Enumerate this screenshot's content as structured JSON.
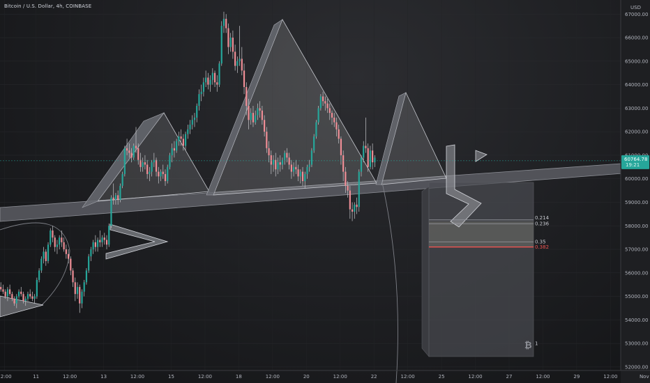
{
  "header": {
    "title": "Bitcoin / U.S. Dollar, 4h, COINBASE"
  },
  "price_axis": {
    "currency": "USD"
  },
  "current_price": {
    "value": "60764.78",
    "countdown": "19:21",
    "price": 60764.78
  },
  "colors": {
    "up": "#26a69a",
    "down": "#ef8e96",
    "wick": "#c8c8cc",
    "price_tag": "#26a69a",
    "fib_0382": "#ef5350"
  },
  "icons": {
    "bitcoin": "bitcoin-icon"
  },
  "chart_data": {
    "type": "candlestick",
    "y_axis": {
      "ticks": [
        67000,
        66000,
        65000,
        64000,
        63000,
        62000,
        61000,
        60000,
        59000,
        58000,
        57000,
        56000,
        55000,
        54000,
        53000,
        52000
      ],
      "tick_labels": [
        "67000.00",
        "66000.00",
        "65000.00",
        "64000.00",
        "63000.00",
        "62000.00",
        "61000.00",
        "60000.00",
        "59000.00",
        "58000.00",
        "57000.00",
        "56000.00",
        "55000.00",
        "54000.00",
        "53000.00",
        "52000.00"
      ],
      "range": [
        51850,
        67600
      ]
    },
    "x_axis": {
      "tick_labels": [
        "12:00",
        "11",
        "12:00",
        "13",
        "12:00",
        "15",
        "12:00",
        "18",
        "12:00",
        "20",
        "12:00",
        "22",
        "12:00",
        "25",
        "12:00",
        "27",
        "12:00",
        "29",
        "12:00",
        "Nov",
        "3"
      ],
      "tick_bars": [
        2,
        16,
        31,
        46,
        61,
        76,
        91,
        106,
        121,
        136,
        151,
        166,
        181,
        196,
        211,
        226,
        241,
        256,
        271,
        286,
        301
      ]
    },
    "fib_levels": [
      {
        "label": "0.214",
        "price": 58250
      },
      {
        "label": "0.236",
        "price": 58090
      },
      {
        "label": "0.35",
        "price": 57320
      },
      {
        "label": "0.382",
        "price": 57100
      },
      {
        "label": "1",
        "price": 53000
      }
    ],
    "candles": [
      [
        55400,
        55600,
        55300,
        55200
      ],
      [
        55300,
        55500,
        55200,
        55100
      ],
      [
        55200,
        55300,
        55000,
        54900
      ],
      [
        55000,
        55400,
        55300,
        54800
      ],
      [
        55300,
        55500,
        55100,
        55000
      ],
      [
        55100,
        55200,
        54900,
        54800
      ],
      [
        54900,
        55000,
        54700,
        54600
      ],
      [
        54700,
        55100,
        55000,
        54500
      ],
      [
        55000,
        55300,
        55200,
        54900
      ],
      [
        55200,
        55400,
        55100,
        55000
      ],
      [
        55100,
        55200,
        54800,
        54700
      ],
      [
        54800,
        55000,
        54900,
        54600
      ],
      [
        54900,
        55200,
        55100,
        54800
      ],
      [
        55100,
        55300,
        55000,
        54900
      ],
      [
        55000,
        55200,
        54900,
        54800
      ],
      [
        54900,
        55100,
        55000,
        54700
      ],
      [
        55000,
        55800,
        55700,
        54900
      ],
      [
        55700,
        56200,
        56100,
        55600
      ],
      [
        56100,
        56700,
        56600,
        56000
      ],
      [
        56600,
        57100,
        56900,
        56400
      ],
      [
        56900,
        57000,
        56500,
        56300
      ],
      [
        56500,
        57300,
        57200,
        56400
      ],
      [
        57200,
        57900,
        57800,
        57100
      ],
      [
        57800,
        58000,
        57500,
        57300
      ],
      [
        57500,
        57600,
        57100,
        56900
      ],
      [
        57100,
        57400,
        57200,
        56800
      ],
      [
        57200,
        57600,
        57500,
        57000
      ],
      [
        57500,
        57800,
        57300,
        57100
      ],
      [
        57300,
        57500,
        57000,
        56900
      ],
      [
        57000,
        57200,
        56800,
        56600
      ],
      [
        56800,
        57000,
        56600,
        56400
      ],
      [
        56600,
        56700,
        56100,
        55900
      ],
      [
        56100,
        56200,
        55600,
        55400
      ],
      [
        55600,
        55800,
        55100,
        54800
      ],
      [
        55100,
        55600,
        55400,
        54900
      ],
      [
        55400,
        55500,
        54700,
        54300
      ],
      [
        54700,
        55300,
        55200,
        54500
      ],
      [
        55200,
        55700,
        55600,
        55000
      ],
      [
        55600,
        56200,
        56100,
        55500
      ],
      [
        56100,
        56800,
        56700,
        56000
      ],
      [
        56700,
        57100,
        57000,
        56500
      ],
      [
        57000,
        57400,
        57300,
        56800
      ],
      [
        57300,
        57600,
        57100,
        56900
      ],
      [
        57100,
        57500,
        57400,
        56900
      ],
      [
        57400,
        57800,
        57300,
        57100
      ],
      [
        57300,
        57600,
        57500,
        57100
      ],
      [
        57500,
        57700,
        57400,
        57200
      ],
      [
        57400,
        57600,
        57200,
        57000
      ],
      [
        57200,
        58100,
        58000,
        57100
      ],
      [
        58000,
        59300,
        59200,
        57900
      ],
      [
        59200,
        59800,
        59100,
        58900
      ],
      [
        59100,
        59400,
        59300,
        58900
      ],
      [
        59300,
        59500,
        59100,
        58900
      ],
      [
        59100,
        59800,
        59700,
        59000
      ],
      [
        59700,
        60300,
        60200,
        59600
      ],
      [
        60200,
        61400,
        61300,
        60100
      ],
      [
        61300,
        61700,
        61200,
        61000
      ],
      [
        61200,
        61500,
        61100,
        60900
      ],
      [
        61100,
        61300,
        60900,
        60700
      ],
      [
        60900,
        61500,
        61400,
        60800
      ],
      [
        61400,
        62200,
        61300,
        61100
      ],
      [
        61300,
        61500,
        60800,
        60600
      ],
      [
        60800,
        61100,
        60500,
        60300
      ],
      [
        60500,
        60900,
        60700,
        60300
      ],
      [
        60700,
        61000,
        60600,
        60400
      ],
      [
        60600,
        60800,
        60200,
        60000
      ],
      [
        60200,
        60500,
        60300,
        59900
      ],
      [
        60300,
        60800,
        60700,
        60100
      ],
      [
        60700,
        61100,
        60800,
        60500
      ],
      [
        60800,
        60900,
        60300,
        60100
      ],
      [
        60300,
        60500,
        60100,
        59800
      ],
      [
        60100,
        60400,
        60300,
        59900
      ],
      [
        60300,
        60600,
        60200,
        60000
      ],
      [
        60200,
        60400,
        59900,
        59700
      ],
      [
        59900,
        60600,
        60500,
        59800
      ],
      [
        60500,
        61100,
        61000,
        60400
      ],
      [
        61000,
        61500,
        61300,
        60700
      ],
      [
        61300,
        61600,
        61200,
        60900
      ],
      [
        61200,
        61700,
        61600,
        61100
      ],
      [
        61600,
        62000,
        61800,
        61400
      ],
      [
        61800,
        62100,
        61700,
        61400
      ],
      [
        61700,
        61900,
        61400,
        61200
      ],
      [
        61400,
        62000,
        61900,
        61200
      ],
      [
        61900,
        62300,
        62100,
        61700
      ],
      [
        62100,
        62500,
        62300,
        61900
      ],
      [
        62300,
        62700,
        62500,
        62100
      ],
      [
        62500,
        62800,
        62600,
        62200
      ],
      [
        62600,
        63200,
        63100,
        62400
      ],
      [
        63100,
        63800,
        63600,
        62900
      ],
      [
        63600,
        64000,
        63700,
        63300
      ],
      [
        63700,
        64300,
        64100,
        63500
      ],
      [
        64100,
        64600,
        64300,
        63900
      ],
      [
        64300,
        64500,
        64000,
        63800
      ],
      [
        64000,
        64400,
        64200,
        63700
      ],
      [
        64200,
        64700,
        64500,
        64000
      ],
      [
        64500,
        64600,
        64100,
        63900
      ],
      [
        64100,
        64400,
        64000,
        63700
      ],
      [
        64000,
        65000,
        64900,
        63900
      ],
      [
        64900,
        66700,
        66500,
        64800
      ],
      [
        66500,
        67100,
        66800,
        66200
      ],
      [
        66800,
        67000,
        66400,
        66200
      ],
      [
        66400,
        66600,
        65600,
        65300
      ],
      [
        65600,
        66200,
        66000,
        65400
      ],
      [
        66000,
        66300,
        65400,
        65100
      ],
      [
        65400,
        65700,
        64800,
        64600
      ],
      [
        64800,
        65200,
        65000,
        64500
      ],
      [
        65000,
        66500,
        65100,
        64800
      ],
      [
        65100,
        65600,
        64600,
        64400
      ],
      [
        64600,
        64900,
        63900,
        63600
      ],
      [
        63900,
        64100,
        63100,
        62700
      ],
      [
        63100,
        63400,
        62500,
        62100
      ],
      [
        62500,
        63000,
        62800,
        62300
      ],
      [
        62800,
        63100,
        62400,
        62200
      ],
      [
        62400,
        62900,
        62700,
        62300
      ],
      [
        62700,
        63200,
        63000,
        62500
      ],
      [
        63000,
        63300,
        62900,
        62600
      ],
      [
        62900,
        63100,
        62500,
        62300
      ],
      [
        62500,
        62700,
        62000,
        61800
      ],
      [
        62000,
        62200,
        61300,
        61100
      ],
      [
        61300,
        61600,
        61000,
        60700
      ],
      [
        61000,
        61200,
        60600,
        60200
      ],
      [
        60600,
        61000,
        60800,
        60300
      ],
      [
        60800,
        61100,
        60400,
        60100
      ],
      [
        60400,
        60900,
        60700,
        60200
      ],
      [
        60700,
        61000,
        60600,
        60300
      ],
      [
        60600,
        60900,
        60800,
        60400
      ],
      [
        60800,
        61200,
        61100,
        60600
      ],
      [
        61100,
        61300,
        60900,
        60700
      ],
      [
        60900,
        61100,
        60600,
        60400
      ],
      [
        60600,
        60800,
        60300,
        60000
      ],
      [
        60300,
        60700,
        60500,
        60100
      ],
      [
        60500,
        60800,
        60400,
        60200
      ],
      [
        60400,
        60600,
        60100,
        59900
      ],
      [
        60100,
        60400,
        60300,
        59800
      ],
      [
        60300,
        60500,
        59900,
        59700
      ],
      [
        59900,
        60300,
        60200,
        59600
      ],
      [
        60200,
        60600,
        60500,
        60000
      ],
      [
        60500,
        60800,
        60600,
        60300
      ],
      [
        60600,
        61300,
        61200,
        60500
      ],
      [
        61200,
        61900,
        61800,
        61100
      ],
      [
        61800,
        62500,
        62400,
        61700
      ],
      [
        62400,
        63100,
        63000,
        62300
      ],
      [
        63000,
        63600,
        63500,
        62900
      ],
      [
        63500,
        63700,
        63300,
        63100
      ],
      [
        63300,
        63500,
        63200,
        62900
      ],
      [
        63200,
        63400,
        63000,
        62800
      ],
      [
        63000,
        63200,
        62800,
        62500
      ],
      [
        62800,
        62900,
        62600,
        62300
      ],
      [
        62600,
        62800,
        62400,
        62200
      ],
      [
        62400,
        62600,
        62100,
        61800
      ],
      [
        62100,
        62300,
        61700,
        61500
      ],
      [
        61700,
        61800,
        61000,
        60600
      ],
      [
        61000,
        61200,
        60300,
        59900
      ],
      [
        60300,
        60500,
        59700,
        59400
      ],
      [
        59700,
        59900,
        59500,
        59200
      ],
      [
        59500,
        59700,
        58700,
        58300
      ],
      [
        58700,
        59000,
        58600,
        58200
      ],
      [
        58600,
        59000,
        58900,
        58300
      ],
      [
        58900,
        59200,
        58800,
        58500
      ],
      [
        58800,
        60400,
        60300,
        58600
      ],
      [
        60300,
        61000,
        60900,
        60100
      ],
      [
        60900,
        61600,
        61400,
        60700
      ],
      [
        61400,
        62600,
        61300,
        61100
      ],
      [
        61300,
        61500,
        60500,
        60300
      ],
      [
        60500,
        61400,
        61200,
        60400
      ],
      [
        61200,
        61500,
        60700,
        60400
      ],
      [
        60700,
        61000,
        60900,
        60500
      ]
    ]
  }
}
